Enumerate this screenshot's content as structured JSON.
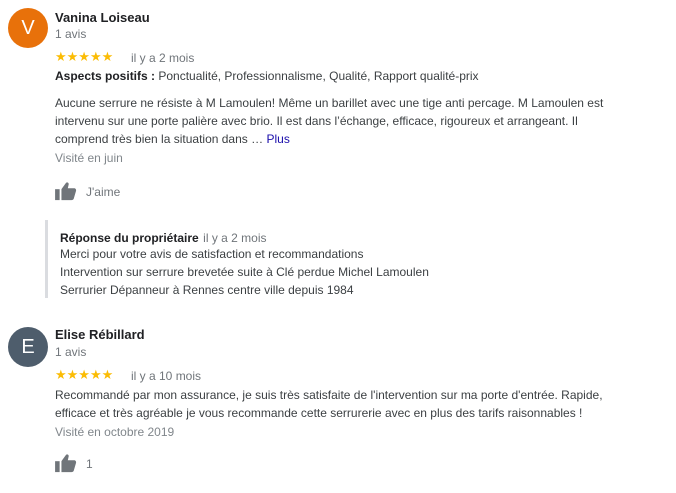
{
  "colors": {
    "avatar1": "#e8710a",
    "avatar2": "#4e5d6c",
    "stars": "#fbbc04",
    "link": "#1a0dab"
  },
  "reviews": [
    {
      "avatar_letter": "V",
      "name": "Vanina Loiseau",
      "count": "1 avis",
      "stars": "★★★★★",
      "time": "il y a 2 mois",
      "aspects_label": "Aspects positifs :",
      "aspects_value": "Ponctualité, Professionnalisme, Qualité, Rapport qualité-prix",
      "text_line1": "Aucune serrure ne résiste à M Lamoulen! Même un barillet avec une tige anti percage. M Lamoulen est",
      "text_line2": "intervenu sur une porte palière avec brio. Il est dans l’échange, efficace, rigoureux et arrangeant. Il",
      "text_line3": "comprend très bien la situation dans …",
      "more": "Plus",
      "visited": "Visité en juin",
      "like_label": "J'aime",
      "reply": {
        "title": "Réponse du propriétaire",
        "time": "il y a 2 mois",
        "line1": "Merci pour votre avis de satisfaction et recommandations",
        "line2": "Intervention sur serrure brevetée suite à Clé perdue Michel Lamoulen",
        "line3": "Serrurier Dépanneur à Rennes centre ville depuis 1984"
      }
    },
    {
      "avatar_letter": "E",
      "name": "Elise Rébillard",
      "count": "1 avis",
      "stars": "★★★★★",
      "time": "il y a 10 mois",
      "text_line1": "Recommandé par mon assurance, je suis très satisfaite de l'intervention sur ma porte d'entrée. Rapide,",
      "text_line2": "efficace et très agréable je vous recommande cette serrurerie avec en plus des tarifs raisonnables !",
      "visited": "Visité en octobre 2019",
      "like_label": "1"
    }
  ]
}
